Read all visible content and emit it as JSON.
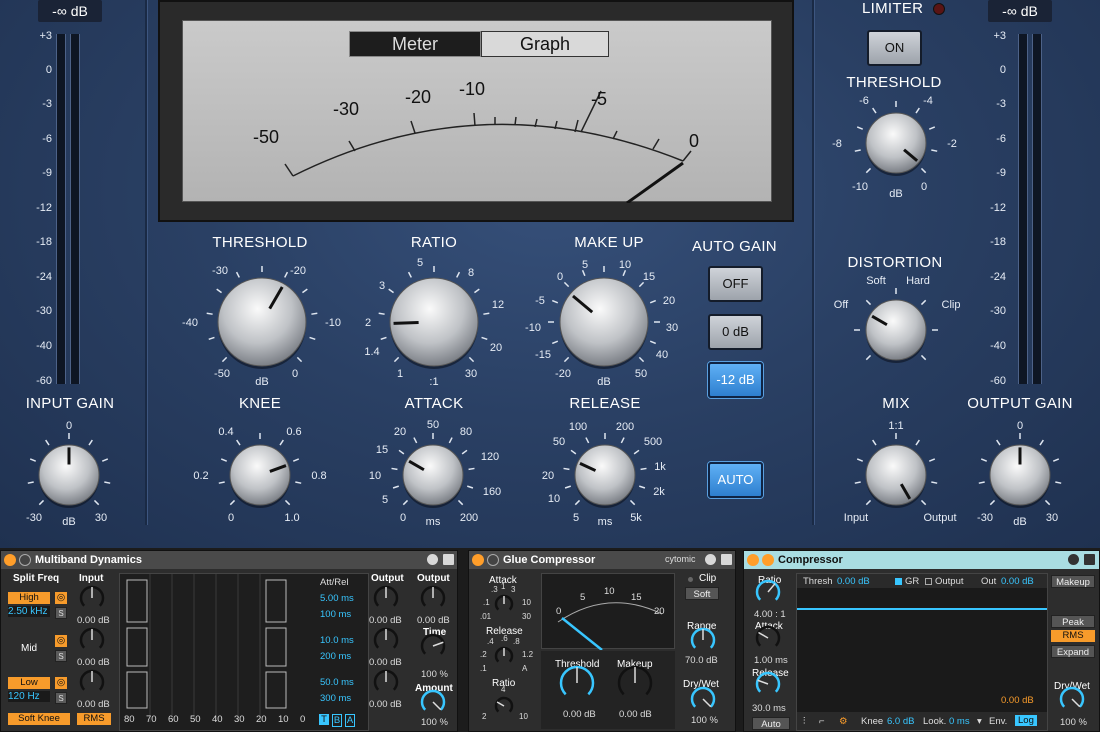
{
  "top_readouts": {
    "input": "-∞ dB",
    "output": "-∞ dB"
  },
  "meter_scale": [
    "+3",
    "0",
    "-3",
    "-6",
    "-9",
    "-12",
    "-18",
    "-24",
    "-30",
    "-40",
    "-60"
  ],
  "meter": {
    "tabs": [
      "Meter",
      "Graph"
    ],
    "active_tab": "Meter",
    "scale": [
      "-50",
      "-30",
      "-20",
      "-10",
      "-5",
      "0"
    ]
  },
  "knobs": {
    "threshold": {
      "label": "THRESHOLD",
      "ticks": [
        "-30",
        "-20",
        "-40",
        "-10",
        "-50",
        "0"
      ],
      "unit": "dB"
    },
    "ratio": {
      "label": "RATIO",
      "ticks": [
        "5",
        "3",
        "8",
        "2",
        "12",
        "1.4",
        "20",
        "1",
        "30"
      ],
      "unit": ":1"
    },
    "makeup": {
      "label": "MAKE UP",
      "ticks": [
        "0",
        "5",
        "10",
        "-5",
        "15",
        "-10",
        "20",
        "-15",
        "30",
        "-20",
        "40",
        "50"
      ],
      "unit": "dB"
    },
    "knee": {
      "label": "KNEE",
      "ticks": [
        "0.4",
        "0.6",
        "0.2",
        "0.8",
        "0",
        "1.0"
      ]
    },
    "attack": {
      "label": "ATTACK",
      "ticks": [
        "20",
        "50",
        "80",
        "15",
        "120",
        "10",
        "160",
        "5",
        "0",
        "200"
      ],
      "unit": "ms"
    },
    "release": {
      "label": "RELEASE",
      "ticks": [
        "100",
        "200",
        "50",
        "500",
        "20",
        "1k",
        "10",
        "2k",
        "5",
        "5k"
      ],
      "unit": "ms"
    },
    "input_gain": {
      "label": "INPUT GAIN",
      "ticks": [
        "0",
        "-30",
        "30"
      ],
      "unit": "dB"
    },
    "limiter_threshold": {
      "label": "THRESHOLD",
      "ticks": [
        "-6",
        "-4",
        "-8",
        "-2",
        "-10",
        "0"
      ],
      "unit": "dB"
    },
    "distortion": {
      "label": "DISTORTION",
      "ticks": [
        "Soft",
        "Hard",
        "Off",
        "Clip"
      ]
    },
    "mix": {
      "label": "MIX",
      "ticks": [
        "1:1",
        "Input",
        "Output"
      ]
    },
    "output_gain": {
      "label": "OUTPUT GAIN",
      "ticks": [
        "0",
        "-30",
        "30"
      ],
      "unit": "dB"
    }
  },
  "auto_gain": {
    "label": "AUTO GAIN",
    "buttons": [
      "OFF",
      "0 dB",
      "-12 dB"
    ],
    "selected": "-12 dB"
  },
  "auto_button": "AUTO",
  "limiter": {
    "label": "LIMITER",
    "button": "ON"
  },
  "multiband": {
    "title": "Multiband Dynamics",
    "split_freq": "Split Freq",
    "high": "High",
    "high_freq": "2.50 kHz",
    "mid": "Mid",
    "low": "Low",
    "low_freq": "120 Hz",
    "input_label": "Input",
    "input_values": [
      "0.00 dB",
      "0.00 dB",
      "0.00 dB"
    ],
    "att_rel": "Att/Rel",
    "att_rel_values": [
      "5.00 ms",
      "100 ms",
      "10.0 ms",
      "200 ms",
      "50.0 ms",
      "300 ms"
    ],
    "x_axis": [
      "80",
      "70",
      "60",
      "50",
      "40",
      "30",
      "20",
      "10",
      "0"
    ],
    "tba": [
      "T",
      "B",
      "A"
    ],
    "output_label": "Output",
    "output_values": [
      "0.00 dB",
      "0.00 dB",
      "0.00 dB"
    ],
    "output2_label": "Output",
    "output2_value": "0.00 dB",
    "time_label": "Time",
    "time_value": "100 %",
    "amount_label": "Amount",
    "amount_value": "100 %",
    "soft_knee": "Soft Knee",
    "rms": "RMS"
  },
  "glue": {
    "title": "Glue Compressor",
    "brand": "cytomic",
    "attack": "Attack",
    "attack_ticks": [
      ".3",
      "1",
      "3",
      ".1",
      "10",
      ".01",
      "30"
    ],
    "release": "Release",
    "release_ticks": [
      ".4",
      ".6",
      ".8",
      ".2",
      "1.2",
      ".1",
      "A"
    ],
    "ratio": "Ratio",
    "ratio_ticks": [
      "4",
      "2",
      "10"
    ],
    "meter_ticks": [
      "0",
      "5",
      "10",
      "15",
      "20"
    ],
    "threshold": "Threshold",
    "threshold_value": "0.00 dB",
    "makeup": "Makeup",
    "makeup_value": "0.00 dB",
    "clip": "Clip",
    "soft": "Soft",
    "range": "Range",
    "range_value": "70.0 dB",
    "drywet": "Dry/Wet",
    "drywet_value": "100 %"
  },
  "comp": {
    "title": "Compressor",
    "ratio": "Ratio",
    "ratio_value": "4.00 : 1",
    "attack": "Attack",
    "attack_value": "1.00 ms",
    "release": "Release",
    "release_value": "30.0 ms",
    "auto": "Auto",
    "thresh": "Thresh",
    "thresh_value": "0.00 dB",
    "gr": "GR",
    "output": "Output",
    "out": "Out",
    "out_value": "0.00 dB",
    "graph_value": "0.00 dB",
    "knee": "Knee",
    "knee_value": "6.0 dB",
    "look": "Look.",
    "look_value": "0 ms",
    "env": "Env.",
    "env_value": "Log",
    "makeup": "Makeup",
    "peak": "Peak",
    "rms": "RMS",
    "expand": "Expand",
    "drywet": "Dry/Wet",
    "drywet_value": "100 %"
  },
  "colors": {
    "panel": "#2a4064",
    "accent_blue": "#38c6ff",
    "orange": "#f79b2b"
  }
}
